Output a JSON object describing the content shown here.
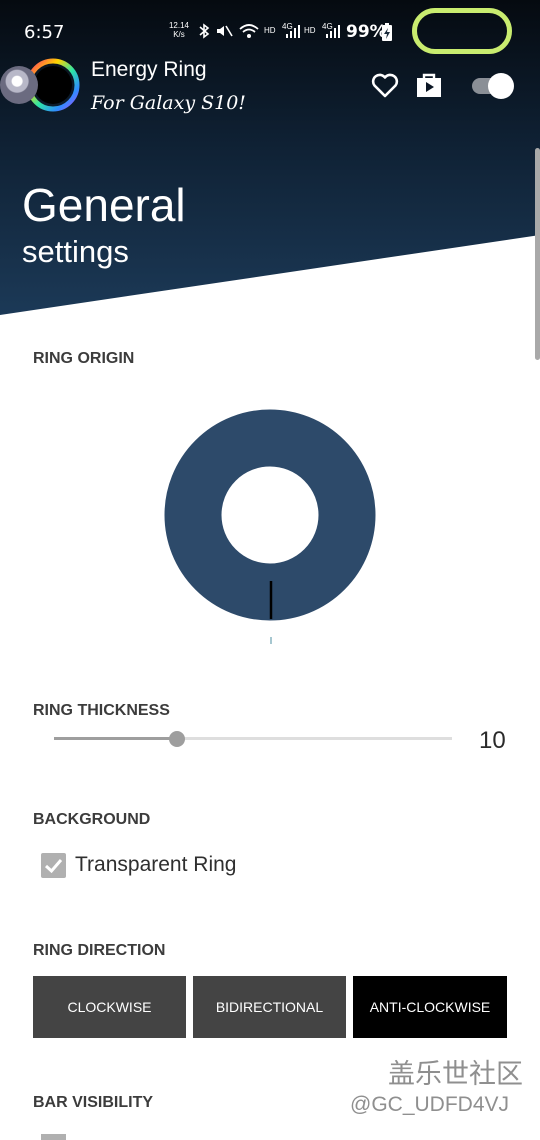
{
  "status_bar": {
    "time": "6:57",
    "net_speed_value": "12.14",
    "net_speed_unit": "K/s",
    "hd1": "HD",
    "lte1": "4G",
    "hd2": "HD",
    "lte2": "4G",
    "battery": "99%"
  },
  "app_bar": {
    "title": "Energy Ring",
    "subtitle": "For Galaxy S10!",
    "icons": {
      "favorite": "heart-icon",
      "store": "shopping-bag-icon",
      "master_toggle": "toggle-switch"
    }
  },
  "hero": {
    "title": "General",
    "subtitle": "settings"
  },
  "sections": {
    "ring_origin": {
      "label": "RING ORIGIN"
    },
    "ring_thickness": {
      "label": "RING THICKNESS",
      "value": "10",
      "fraction": 0.31
    },
    "background": {
      "label": "BACKGROUND",
      "checkbox_label": "Transparent Ring",
      "checked": true
    },
    "ring_direction": {
      "label": "RING DIRECTION",
      "options": [
        "CLOCKWISE",
        "BIDIRECTIONAL",
        "ANTI-CLOCKWISE"
      ],
      "selected": "ANTI-CLOCKWISE"
    },
    "bar_visibility": {
      "label": "BAR VISIBILITY"
    }
  },
  "watermark": {
    "site": "盖乐世社区",
    "user": "@GC_UDFD4VJ"
  },
  "colors": {
    "ring": "#2d4a6a",
    "accent_pill": "#c9ec6f",
    "button": "#444444",
    "button_selected": "#000000"
  }
}
